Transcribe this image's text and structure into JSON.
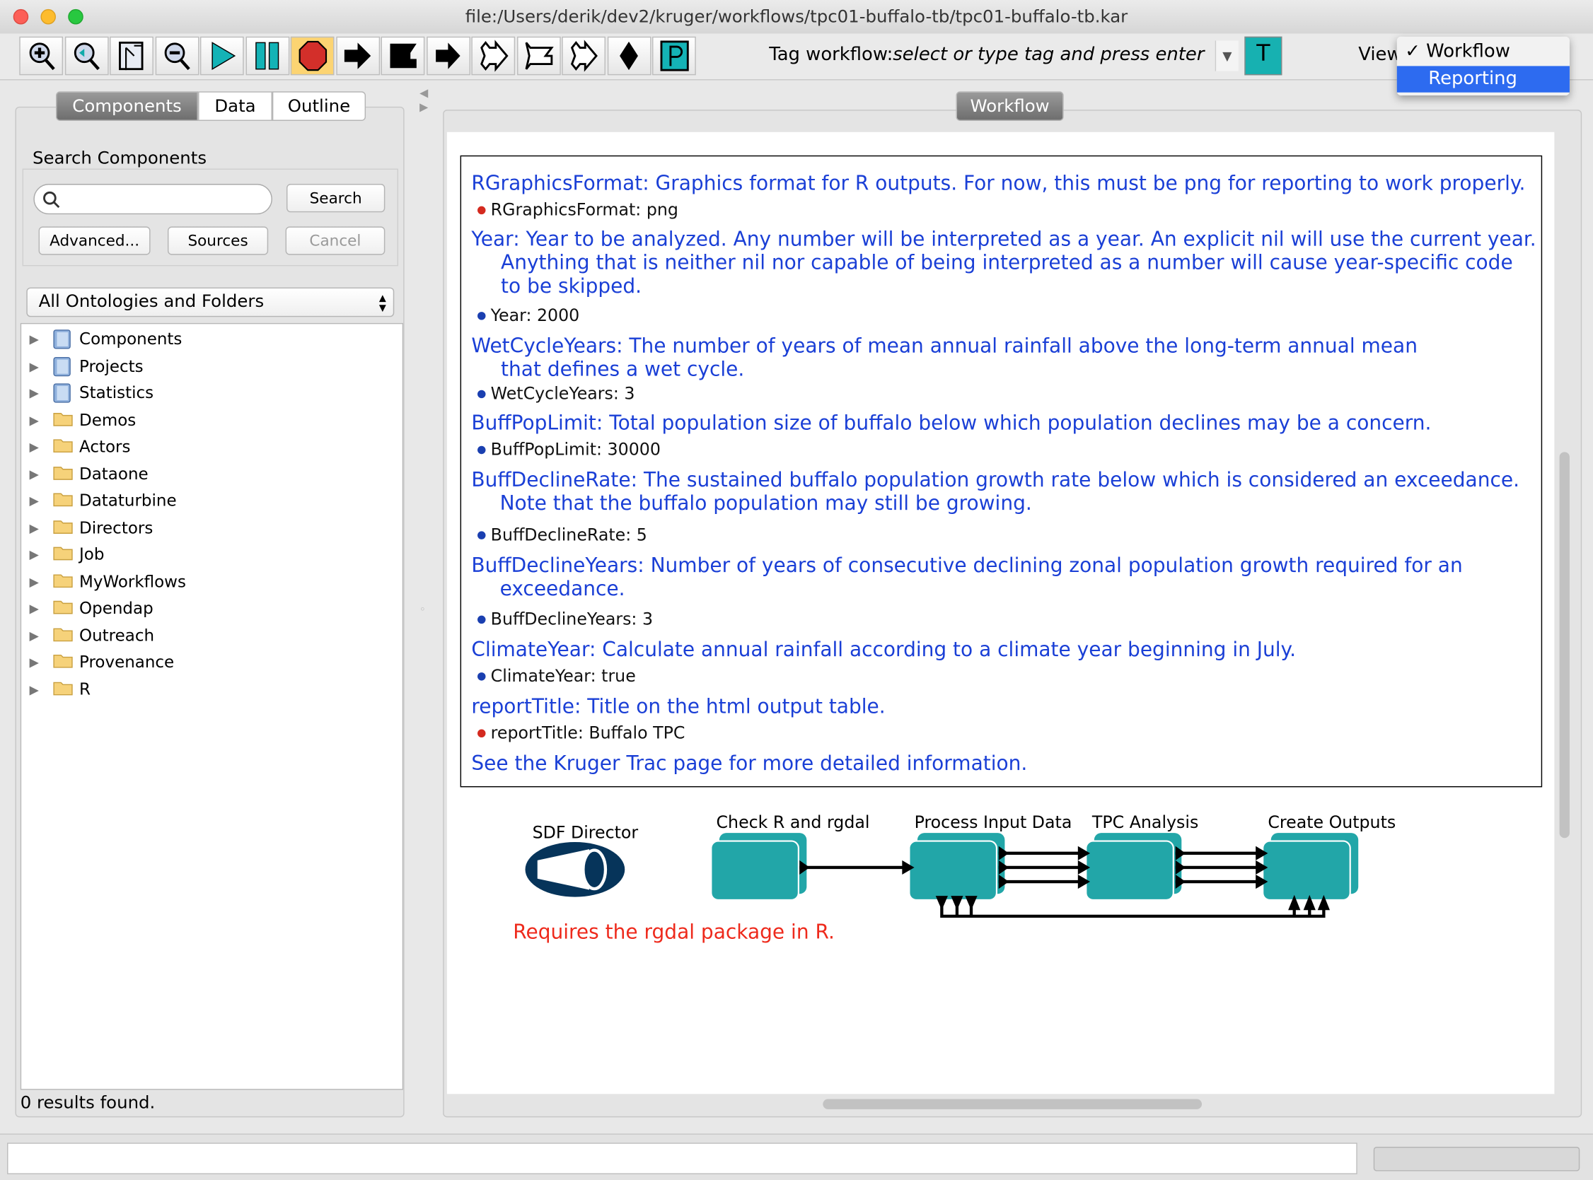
{
  "window": {
    "title": "file:/Users/derik/dev2/kruger/workflows/tpc01-buffalo-tb/tpc01-buffalo-tb.kar"
  },
  "toolbar": {
    "buttons": [
      "zoom-in",
      "zoom-reset",
      "zoom-fit",
      "zoom-out",
      "run",
      "pause",
      "stop",
      "step-arrow",
      "flag-arrow",
      "short-arrow",
      "zigzag-arrow",
      "zigzag-flag",
      "zigzag-short",
      "diamond",
      "p-button"
    ],
    "tag_label": "Tag workflow:",
    "tag_placeholder": "select or type tag and press enter",
    "tag_button": "T",
    "view_label": "View"
  },
  "view_menu": {
    "items": [
      {
        "label": "Workflow",
        "checked": true,
        "check": "✓"
      },
      {
        "label": "Reporting",
        "selected": true
      }
    ]
  },
  "left": {
    "tabs": [
      "Components",
      "Data",
      "Outline"
    ],
    "active_tab": "Components",
    "search_title": "Search Components",
    "search_value": "",
    "search_button": "Search",
    "advanced_button": "Advanced...",
    "sources_button": "Sources",
    "cancel_button": "Cancel",
    "ontology_select": "All Ontologies and Folders",
    "tree": [
      {
        "label": "Components",
        "icon": "book"
      },
      {
        "label": "Projects",
        "icon": "book"
      },
      {
        "label": "Statistics",
        "icon": "book"
      },
      {
        "label": "Demos",
        "icon": "folder"
      },
      {
        "label": "Actors",
        "icon": "folder"
      },
      {
        "label": "Dataone",
        "icon": "folder"
      },
      {
        "label": "Dataturbine",
        "icon": "folder"
      },
      {
        "label": "Directors",
        "icon": "folder"
      },
      {
        "label": "Job",
        "icon": "folder"
      },
      {
        "label": "MyWorkflows",
        "icon": "folder"
      },
      {
        "label": "Opendap",
        "icon": "folder"
      },
      {
        "label": "Outreach",
        "icon": "folder"
      },
      {
        "label": "Provenance",
        "icon": "folder"
      },
      {
        "label": "R",
        "icon": "folder"
      }
    ],
    "results": "0 results found."
  },
  "right": {
    "tab": "Workflow",
    "annotations": [
      {
        "lines": [
          "RGraphicsFormat: Graphics format for R outputs.  For now, this must be png for reporting to work properly."
        ],
        "param": "RGraphicsFormat: png",
        "color": "#d42a1f"
      },
      {
        "lines": [
          "Year: Year to be analyzed.  Any number will be interpreted as a year.  An explicit nil will use the current year.",
          "Anything that is neither nil nor capable of being interpreted as a number will cause year-specific code",
          "to be skipped."
        ],
        "param": "Year: 2000",
        "color": "#1a3fb0"
      },
      {
        "lines": [
          "WetCycleYears: The number of years of mean annual rainfall above the long-term annual mean",
          "that defines a wet cycle."
        ],
        "param": "WetCycleYears: 3",
        "color": "#1a3fb0"
      },
      {
        "lines": [
          "BuffPopLimit: Total population size of buffalo below which population declines may be a concern."
        ],
        "param": "BuffPopLimit: 30000",
        "color": "#1a3fb0"
      },
      {
        "lines": [
          "BuffDeclineRate: The sustained buffalo population growth rate below which is considered an exceedance.",
          "Note that the buffalo population may still be growing."
        ],
        "param": "BuffDeclineRate: 5",
        "color": "#1a3fb0"
      },
      {
        "lines": [
          "BuffDeclineYears: Number of years of consecutive declining zonal population growth required for an",
          "exceedance."
        ],
        "param": "BuffDeclineYears: 3",
        "color": "#1a3fb0"
      },
      {
        "lines": [
          "ClimateYear: Calculate annual rainfall according to a climate year beginning in July."
        ],
        "param": "ClimateYear: true",
        "color": "#1a3fb0"
      },
      {
        "lines": [
          "reportTitle: Title on the html output table."
        ],
        "param": "reportTitle: Buffalo TPC",
        "color": "#d42a1f"
      }
    ],
    "footer_note": "See the Kruger Trac page for more detailed information.",
    "director": "SDF Director",
    "actors": [
      "Check R and rgdal",
      "Process Input Data",
      "TPC Analysis",
      "Create Outputs"
    ],
    "requirement": "Requires the rgdal package in R.",
    "actor_color": "#22a6a8",
    "director_color": "#06345a"
  },
  "status": {
    "value": ""
  }
}
